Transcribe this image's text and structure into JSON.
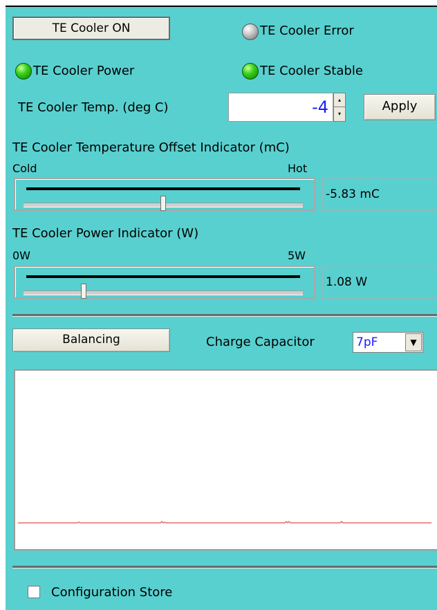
{
  "buttons": {
    "cooler_on": "TE Cooler ON",
    "apply": "Apply",
    "balancing": "Balancing"
  },
  "indicators": {
    "error": "TE Cooler Error",
    "power": "TE Cooler Power",
    "stable": "TE Cooler Stable"
  },
  "temp": {
    "label": "TE Cooler Temp. (deg C)",
    "value": "-4"
  },
  "offset": {
    "title": "TE Cooler Temperature Offset Indicator (mC)",
    "min_label": "Cold",
    "max_label": "Hot",
    "readout": "-5.83 mC",
    "level": 0.5
  },
  "power_ind": {
    "title": "TE Cooler Power Indicator (W)",
    "min_label": "0W",
    "max_label": "5W",
    "readout": "1.08 W",
    "level": 0.216
  },
  "capacitor": {
    "label": "Charge Capacitor",
    "value": "7pF"
  },
  "config": {
    "label": "Configuration Store"
  },
  "colors": {
    "panel": "#58d0cf",
    "trace": "#e36b6b",
    "value_blue": "#1a1aff"
  },
  "icons": {
    "spin_up": "▴",
    "spin_down": "▾",
    "dropdown": "▼"
  }
}
